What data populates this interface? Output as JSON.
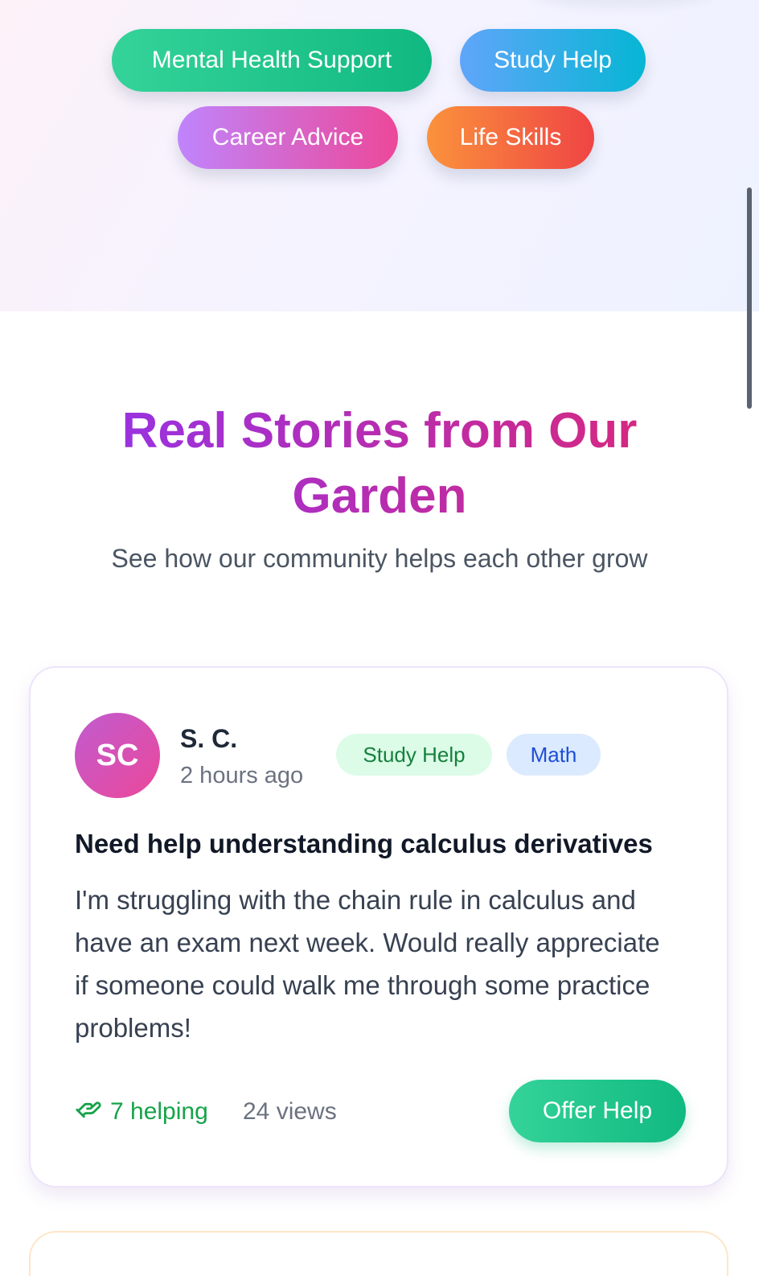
{
  "categories": [
    {
      "label": "Mental Health Support",
      "color_from": "#34d399",
      "color_to": "#10b981"
    },
    {
      "label": "Study Help",
      "color_from": "#60a5fa",
      "color_to": "#06b6d4"
    },
    {
      "label": "Career Advice",
      "color_from": "#c084fc",
      "color_to": "#ec4899"
    },
    {
      "label": "Life Skills",
      "color_from": "#fb923c",
      "color_to": "#ef4444"
    }
  ],
  "stories": {
    "title": "Real Stories from Our Garden",
    "subtitle": "See how our community helps each other grow"
  },
  "post": {
    "author_initials": "SC",
    "author_name": "S. C.",
    "time": "2 hours ago",
    "tags": [
      {
        "label": "Study Help",
        "bg": "#dcfce7",
        "fg": "#15803d"
      },
      {
        "label": "Math",
        "bg": "#dbeafe",
        "fg": "#1d4ed8"
      }
    ],
    "title": "Need help understanding calculus derivatives",
    "body": "I'm struggling with the chain rule in calculus and have an exam next week. Would really appreciate if someone could walk me through some practice problems!",
    "helping": "7 helping",
    "helping_icon": "helping-hand-icon",
    "views": "24 views",
    "offer_label": "Offer Help"
  }
}
